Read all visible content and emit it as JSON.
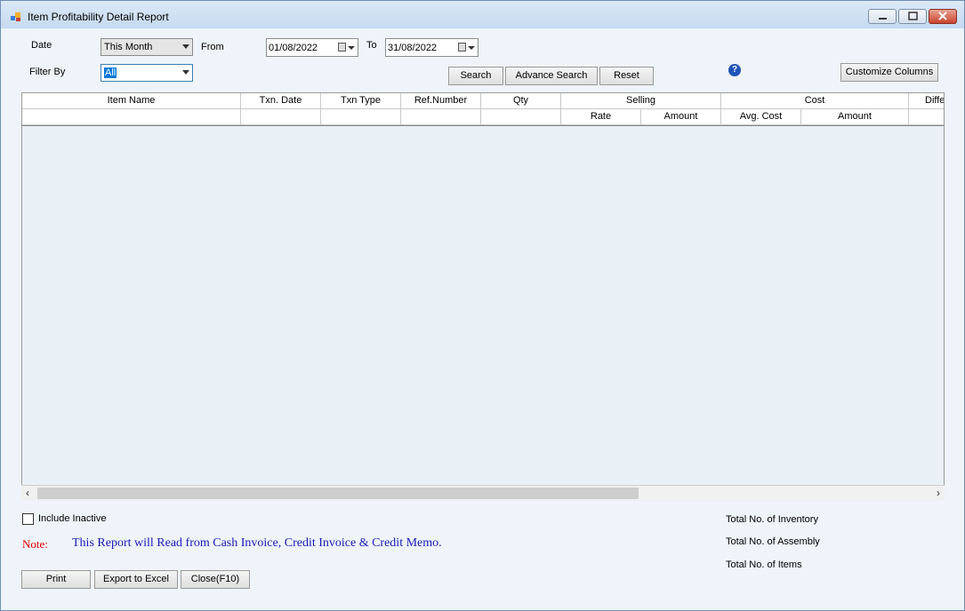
{
  "window": {
    "title": "Item Profitability Detail Report"
  },
  "filters": {
    "date_label": "Date",
    "date_range_value": "This Month",
    "from_label": "From",
    "from_value": "01/08/2022",
    "to_label": "To",
    "to_value": "31/08/2022",
    "filter_by_label": "Filter By",
    "filter_by_value": "All"
  },
  "buttons": {
    "search": "Search",
    "advance_search": "Advance Search",
    "reset": "Reset",
    "customize_columns": "Customize Columns",
    "print": "Print",
    "export_excel": "Export to Excel",
    "close": "Close(F10)"
  },
  "table": {
    "col_item_name": "Item Name",
    "col_txn_date": "Txn. Date",
    "col_txn_type": "Txn Type",
    "col_ref_number": "Ref.Number",
    "col_qty": "Qty",
    "group_selling": "Selling",
    "col_sell_rate": "Rate",
    "col_sell_amount": "Amount",
    "group_cost": "Cost",
    "col_avg_cost": "Avg. Cost",
    "col_cost_amount": "Amount",
    "col_diff": "Diffe"
  },
  "footer": {
    "include_inactive": "Include Inactive",
    "note_label": "Note:",
    "note_text": "This Report will Read from Cash Invoice, Credit Invoice & Credit Memo.",
    "total_inventory": "Total No. of Inventory",
    "total_assembly": "Total No. of Assembly",
    "total_items": "Total No. of Items"
  },
  "icons": {
    "help": "help-icon",
    "app": "app-icon"
  }
}
